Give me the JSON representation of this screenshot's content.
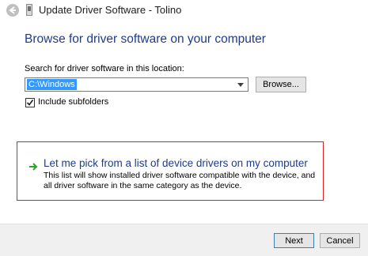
{
  "window": {
    "title": "Update Driver Software - Tolino"
  },
  "main": {
    "heading": "Browse for driver software on your computer",
    "search_label": "Search for driver software in this location:",
    "path_value": "C:\\Windows",
    "browse_label": "Browse...",
    "include_subfolders_label": "Include subfolders",
    "include_subfolders_checked": true,
    "pick_title": "Let me pick from a list of device drivers on my computer",
    "pick_description": "This list will show installed driver software compatible with the device, and all driver software in the same category as the device."
  },
  "footer": {
    "next_label": "Next",
    "cancel_label": "Cancel"
  },
  "icons": {
    "back": "back-arrow-icon",
    "device": "device-icon",
    "dropdown": "chevron-down-icon",
    "check": "checkmark-icon",
    "pick_arrow": "green-arrow-icon"
  },
  "colors": {
    "heading": "#1f3c8c",
    "highlight_border": "#e02020",
    "selection": "#3399ff",
    "pick_arrow": "#2aa52a"
  }
}
